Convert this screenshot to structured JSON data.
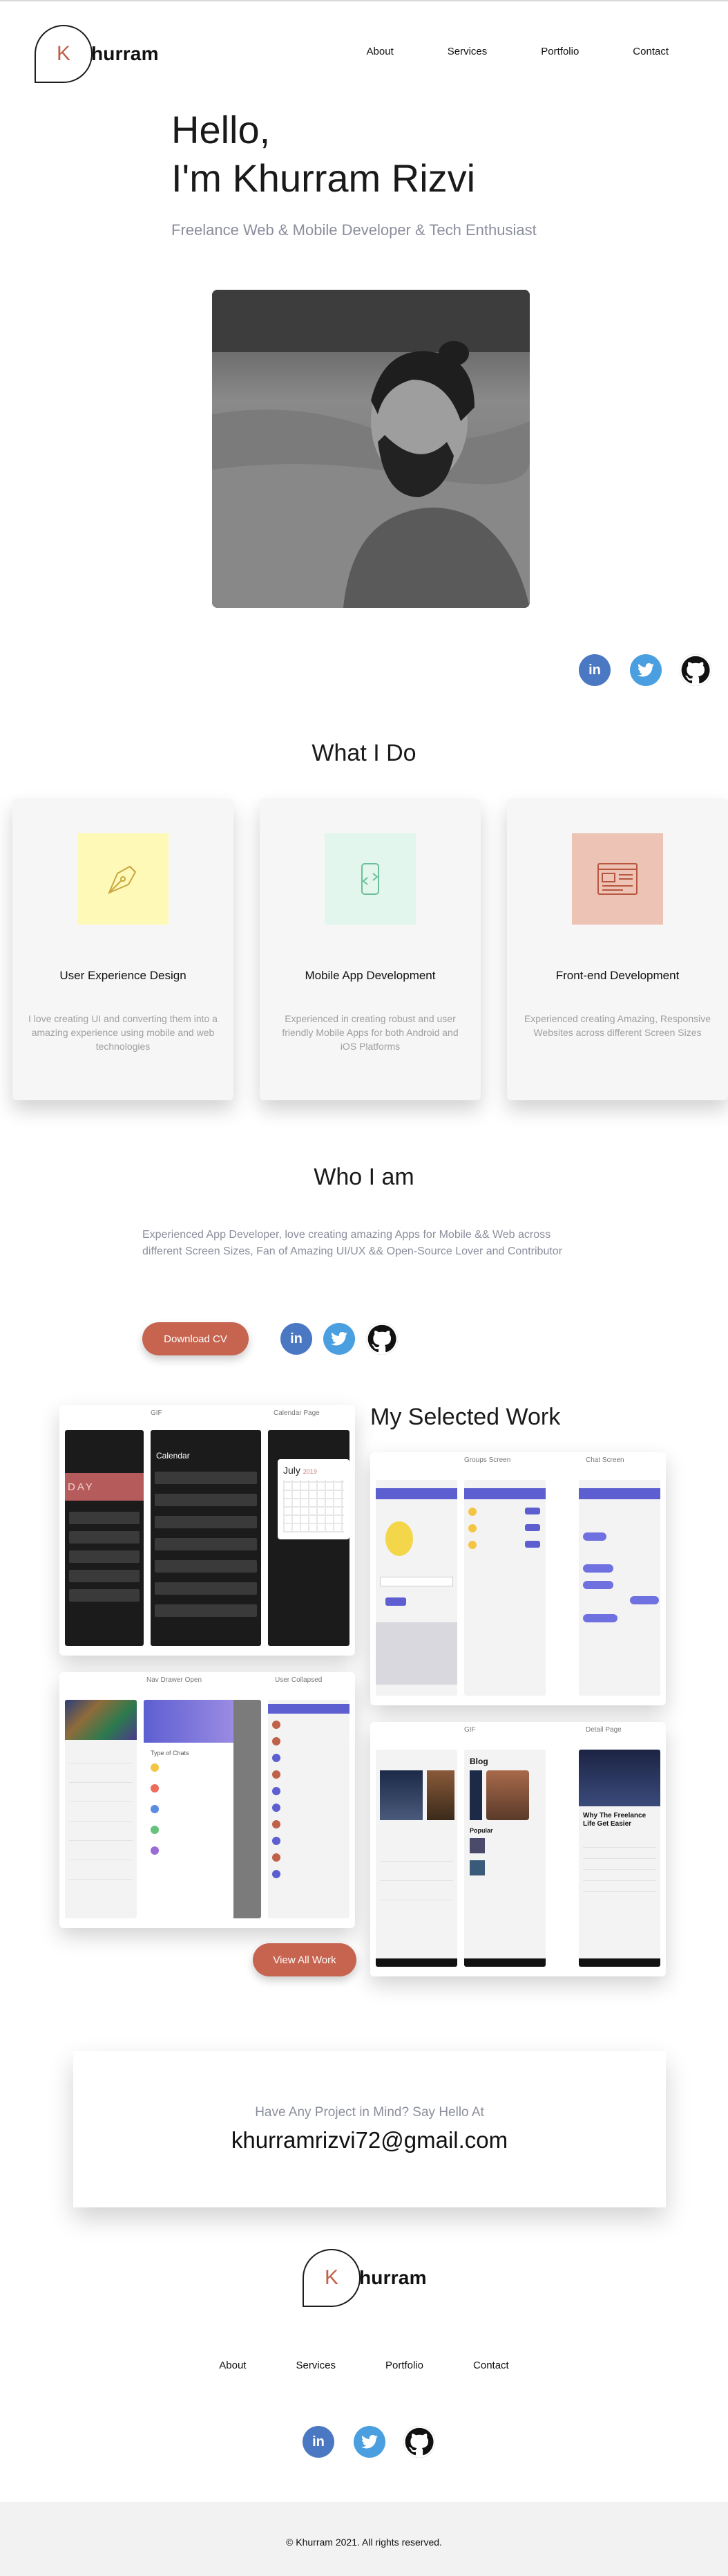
{
  "header": {
    "logo_letter": "K",
    "logo_text": "hurram",
    "nav": [
      "About",
      "Services",
      "Portfolio",
      "Contact"
    ]
  },
  "hero": {
    "greeting": "Hello,",
    "name": "I'm Khurram Rizvi",
    "subtitle": "Freelance Web & Mobile Developer & Tech Enthusiast"
  },
  "social_icons": [
    "linkedin-icon",
    "twitter-icon",
    "github-icon"
  ],
  "what_i_do": {
    "title": "What I Do",
    "cards": [
      {
        "icon": "pen-tool-icon",
        "icon_bg": "#fff9b8",
        "title": "User Experience Design",
        "text": "I love creating UI and converting them into a amazing experience using mobile and web technologies"
      },
      {
        "icon": "mobile-app-icon",
        "icon_bg": "#e3f6ee",
        "title": "Mobile App Development",
        "text": "Experienced in creating robust and user friendly Mobile Apps for both Android and iOS Platforms"
      },
      {
        "icon": "web-layout-icon",
        "icon_bg": "#ecc3b4",
        "title": "Front-end Development",
        "text": "Experienced creating Amazing, Responsive Websites across different Screen Sizes"
      }
    ]
  },
  "who_i_am": {
    "title": "Who I am",
    "text": "Experienced App Developer, love creating amazing Apps for Mobile && Web across different Screen Sizes, Fan of Amazing UI/UX && Open-Source Lover and Contributor",
    "download_label": "Download CV"
  },
  "work": {
    "title": "My Selected Work",
    "view_all_label": "View All Work",
    "shots": [
      {
        "labels": [
          "",
          "GIF",
          "Calendar Page"
        ],
        "calendar_month": "July",
        "calendar_year": "2019",
        "banner": "DAY",
        "calendar_header": "Calendar"
      },
      {
        "labels": [
          "",
          "Groups Screen",
          "Chat Screen"
        ]
      },
      {
        "labels": [
          "",
          "Nav Drawer Open",
          "User Collapsed"
        ],
        "drawer_title": "Type of Chats"
      },
      {
        "labels": [
          "",
          "GIF",
          "Detail Page"
        ],
        "blog_title": "Blog",
        "popular_label": "Popular",
        "detail_headline": "Why The Freelance Life Get Easier"
      }
    ]
  },
  "contact": {
    "question": "Have Any Project in Mind? Say Hello At",
    "email": "khurramrizvi72@gmail.com"
  },
  "footer": {
    "nav": [
      "About",
      "Services",
      "Portfolio",
      "Contact"
    ],
    "copyright": "© Khurram 2021. All rights reserved."
  },
  "colors": {
    "accent": "#c6644f",
    "linkedin": "#4a78c2",
    "twitter": "#4a9fe0",
    "github": "#111111",
    "muted_text": "#8b8e9c"
  }
}
